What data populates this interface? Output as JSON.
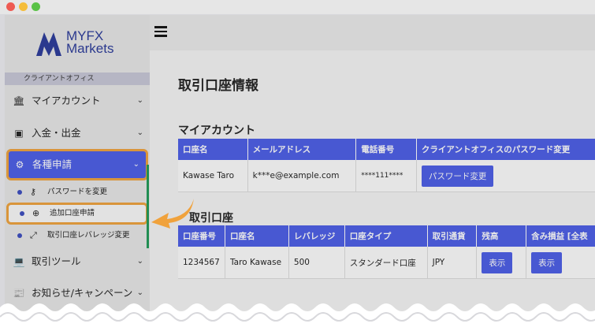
{
  "logo": {
    "line1": "MYFX",
    "line2": "Markets"
  },
  "sidebar": {
    "portal_label": "クライアントオフィス",
    "items": [
      {
        "label": "マイアカウント",
        "icon": "bank-icon"
      },
      {
        "label": "入金・出金",
        "icon": "money-icon"
      },
      {
        "label": "各種申請",
        "icon": "gears-icon",
        "active": true
      },
      {
        "label": "取引ツール",
        "icon": "laptop-icon"
      },
      {
        "label": "お知らせ/キャンペーン",
        "icon": "newspaper-icon"
      }
    ],
    "subitems": [
      {
        "label": "パスワードを変更",
        "icon": "key-icon"
      },
      {
        "label": "追加口座申請",
        "icon": "plus-circle-icon",
        "highlighted": true
      },
      {
        "label": "取引口座レバレッジ変更",
        "icon": "expand-icon"
      }
    ]
  },
  "main": {
    "page_title": "取引口座情報",
    "my_account": {
      "heading": "マイアカウント",
      "headers": [
        "口座名",
        "メールアドレス",
        "電話番号",
        "クライアントオフィスのパスワード変更"
      ],
      "row": {
        "name": "Kawase Taro",
        "email": "k***e@example.com",
        "phone": "****111****",
        "button": "パスワード変更"
      }
    },
    "trading_accounts": {
      "heading": "取引口座",
      "headers": [
        "口座番号",
        "口座名",
        "レバレッジ",
        "口座タイプ",
        "取引通貨",
        "残高",
        "含み損益 [全表"
      ],
      "row": {
        "number": "1234567",
        "name": "Taro Kawase",
        "leverage": "500",
        "type": "スタンダード口座",
        "currency": "JPY",
        "balance_button": "表示",
        "pl_button": "表示"
      }
    }
  },
  "colors": {
    "accent": "#4b5de8",
    "highlight": "#f0a23c",
    "green_bar": "#1e9a56"
  }
}
